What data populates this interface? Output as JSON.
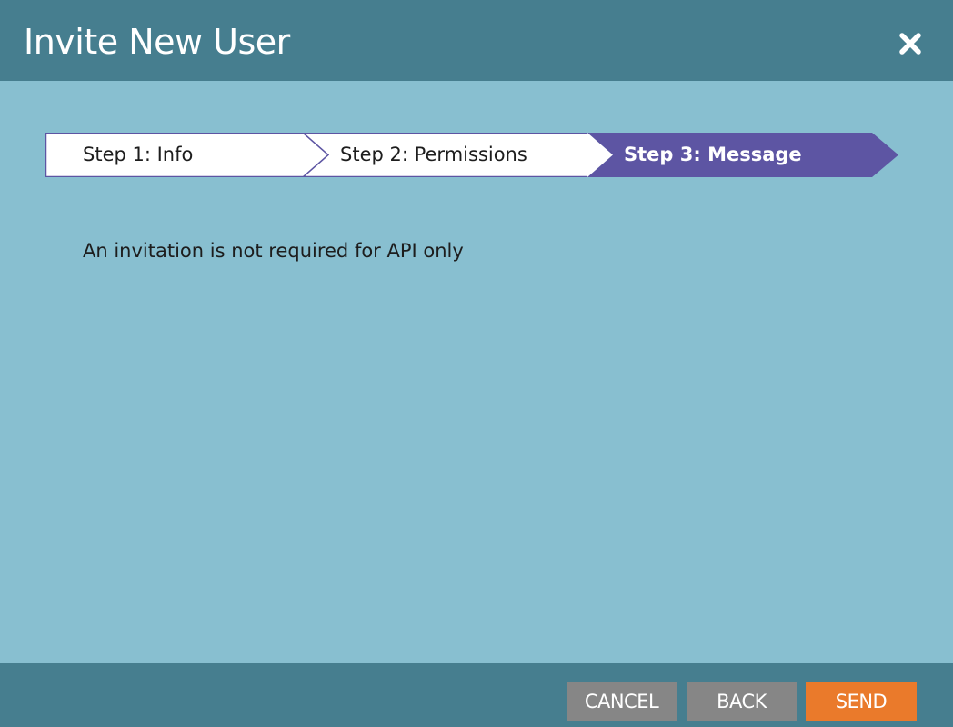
{
  "dialog": {
    "title": "Invite New User",
    "close_icon": "close-icon"
  },
  "stepper": {
    "steps": [
      {
        "label": "Step 1: Info",
        "active": false
      },
      {
        "label": "Step 2: Permissions",
        "active": false
      },
      {
        "label": "Step 3: Message",
        "active": true
      }
    ]
  },
  "content": {
    "message": "An invitation is not required for API only"
  },
  "footer": {
    "cancel_label": "CANCEL",
    "back_label": "BACK",
    "send_label": "SEND"
  },
  "colors": {
    "header_bg": "#467e8f",
    "body_bg": "#88bfd0",
    "active_step": "#5d55a3",
    "inactive_step": "#ffffff",
    "secondary_button": "#868686",
    "primary_button": "#ea7a2b"
  }
}
